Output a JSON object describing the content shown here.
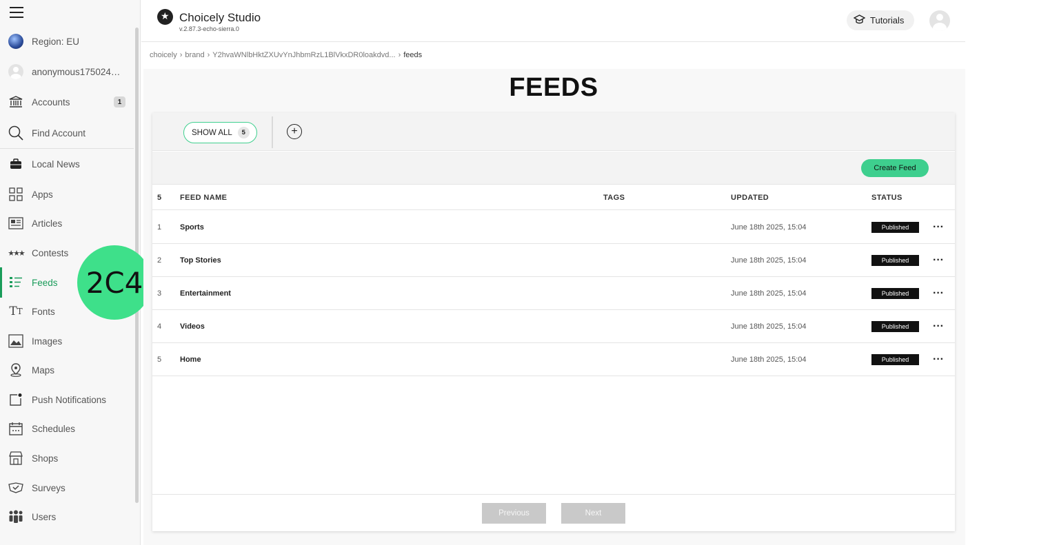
{
  "sidebar": {
    "region_label": "Region: EU",
    "user_label": "anonymous1750248…",
    "items": [
      {
        "label": "Accounts",
        "badge": "1"
      },
      {
        "label": "Find Account"
      },
      {
        "label": "Local News"
      },
      {
        "label": "Apps"
      },
      {
        "label": "Articles"
      },
      {
        "label": "Contests"
      },
      {
        "label": "Feeds"
      },
      {
        "label": "Fonts"
      },
      {
        "label": "Images"
      },
      {
        "label": "Maps"
      },
      {
        "label": "Push Notifications"
      },
      {
        "label": "Schedules"
      },
      {
        "label": "Shops"
      },
      {
        "label": "Surveys"
      },
      {
        "label": "Users"
      }
    ],
    "active_item": "Feeds",
    "overlay_marker": "2C4"
  },
  "header": {
    "app_title": "Choicely Studio",
    "version": "v.2.87.3-echo-sierra.0",
    "tutorials_label": "Tutorials"
  },
  "breadcrumb": {
    "items": [
      "choicely",
      "brand",
      "Y2hvaWNlbHktZXUvYnJhbmRzL1BlVkxDR0loakdvd...",
      "feeds"
    ],
    "separator": "›"
  },
  "page": {
    "title": "FEEDS",
    "filter": {
      "show_all_label": "SHOW ALL",
      "show_all_count": "5"
    },
    "create_button_label": "Create Feed",
    "accent_color": "#3ecf8e"
  },
  "table": {
    "total": "5",
    "headers": {
      "name": "FEED NAME",
      "tags": "TAGS",
      "updated": "UPDATED",
      "status": "STATUS"
    },
    "rows": [
      {
        "num": "1",
        "name": "Sports",
        "tags": "",
        "updated": "June 18th 2025, 15:04",
        "status": "Published"
      },
      {
        "num": "2",
        "name": "Top Stories",
        "tags": "",
        "updated": "June 18th 2025, 15:04",
        "status": "Published"
      },
      {
        "num": "3",
        "name": "Entertainment",
        "tags": "",
        "updated": "June 18th 2025, 15:04",
        "status": "Published"
      },
      {
        "num": "4",
        "name": "Videos",
        "tags": "",
        "updated": "June 18th 2025, 15:04",
        "status": "Published"
      },
      {
        "num": "5",
        "name": "Home",
        "tags": "",
        "updated": "June 18th 2025, 15:04",
        "status": "Published"
      }
    ],
    "more_label": "···"
  },
  "pagination": {
    "previous_label": "Previous",
    "next_label": "Next"
  }
}
